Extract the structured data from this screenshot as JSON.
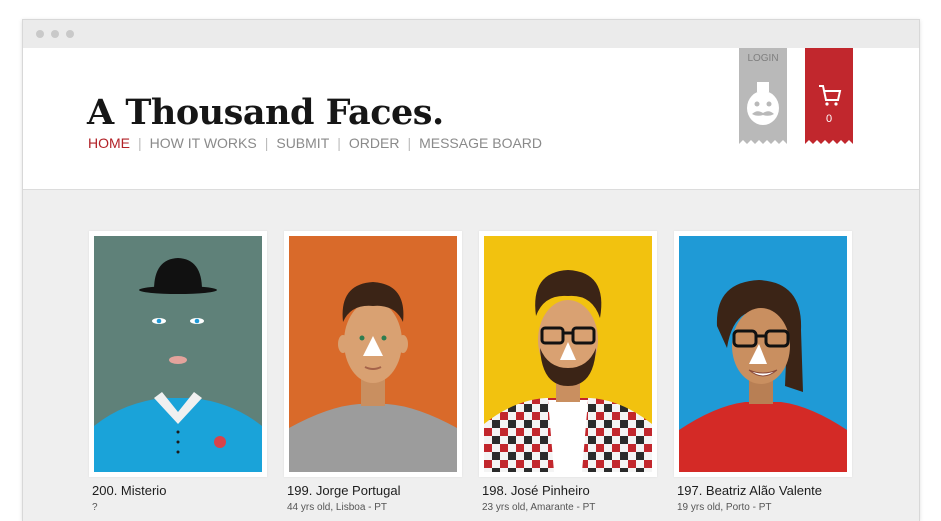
{
  "site": {
    "title": "A Thousand Faces.",
    "nav": [
      {
        "label": "HOME",
        "active": true
      },
      {
        "label": "HOW IT WORKS",
        "active": false
      },
      {
        "label": "SUBMIT",
        "active": false
      },
      {
        "label": "ORDER",
        "active": false
      },
      {
        "label": "MESSAGE BOARD",
        "active": false
      }
    ],
    "login_label": "LOGIN",
    "cart_count": "0"
  },
  "colors": {
    "accent": "#b22127",
    "login_tag": "#b9b9b9",
    "cart_tag": "#c1272d"
  },
  "icons": {
    "login": "mustache-face-icon",
    "cart": "shopping-cart-icon"
  },
  "faces": [
    {
      "title": "200. Misterio",
      "subtitle": "?",
      "background": "#5f8179"
    },
    {
      "title": "199. Jorge Portugal",
      "subtitle": "44 yrs old, Lisboa - PT",
      "background": "#d96a2a"
    },
    {
      "title": "198. José Pinheiro",
      "subtitle": "23 yrs old, Amarante - PT",
      "background": "#f2c20f"
    },
    {
      "title": "197. Beatriz Alão Valente",
      "subtitle": "19 yrs old, Porto - PT",
      "background": "#1f9ad6"
    }
  ]
}
